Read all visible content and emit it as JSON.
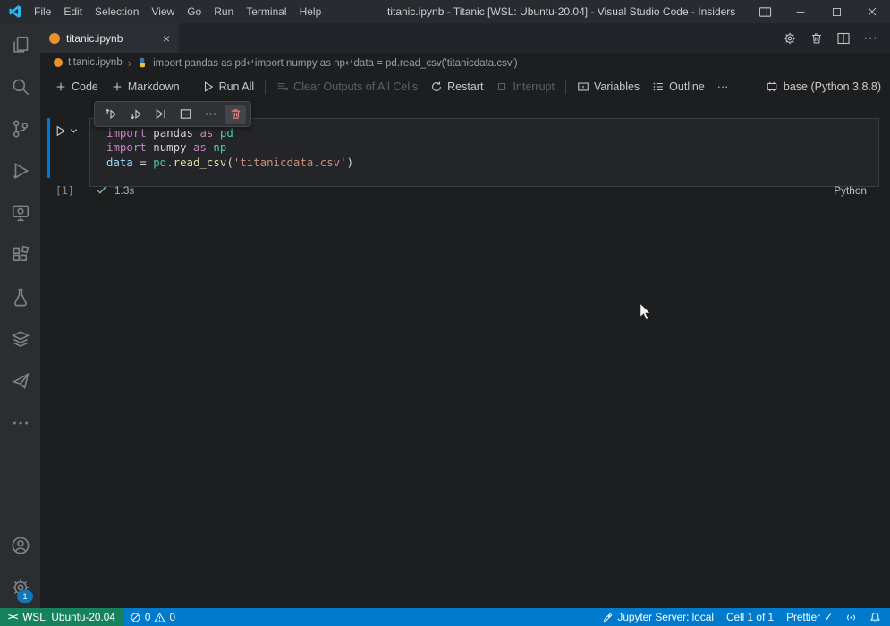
{
  "colors": {
    "titlebar-bg": "#282c30",
    "activitybar-bg": "#2b2d31",
    "editor-bg": "#1d1e20",
    "tabstrip-bg": "#222429",
    "tab-bg": "#2b2e33",
    "cell-editor-bg": "#242528",
    "cell-border": "#3a3d41",
    "toolbar-popup-bg": "#303134",
    "statusbar-bg": "#007acc",
    "remote-bg": "#16825d",
    "focus-blue": "#0078d4",
    "jupyter-orange": "#e8912d",
    "badge-blue": "#1177bb",
    "delete-red": "#f0807a",
    "success-green": "#73c991",
    "logo-teal": "#2fb4e9",
    "syn-kw": "#c586c0",
    "syn-mod": "#d4d4d4",
    "syn-cls": "#4ec9b0",
    "syn-var": "#9cdcfe",
    "syn-fn": "#dcdcaa",
    "syn-str": "#ce9178",
    "syn-plain": "#d4d4d4"
  },
  "icons": {
    "close": "×",
    "chevron": "›",
    "more": "···",
    "remote": "><",
    "check": "✓"
  },
  "titlebar": {
    "menus": [
      "File",
      "Edit",
      "Selection",
      "View",
      "Go",
      "Run",
      "Terminal",
      "Help"
    ],
    "title": "titanic.ipynb - Titanic [WSL: Ubuntu-20.04] - Visual Studio Code - Insiders"
  },
  "tab": {
    "label": "titanic.ipynb"
  },
  "breadcrumb": {
    "file": "titanic.ipynb",
    "cell_preview": "import pandas as pd↵import numpy as np↵data = pd.read_csv('titanicdata.csv')"
  },
  "notebook_toolbar": {
    "code": "Code",
    "markdown": "Markdown",
    "run_all": "Run All",
    "clear_outputs": "Clear Outputs of All Cells",
    "restart": "Restart",
    "interrupt": "Interrupt",
    "variables": "Variables",
    "outline": "Outline",
    "kernel": "base (Python 3.8.8)"
  },
  "cell": {
    "execution_count": "[1]",
    "duration": "1.3s",
    "language": "Python",
    "code_tokens": [
      [
        {
          "t": "import",
          "c": "kw"
        },
        {
          "t": " ",
          "c": "plain"
        },
        {
          "t": "pandas",
          "c": "mod"
        },
        {
          "t": " ",
          "c": "plain"
        },
        {
          "t": "as",
          "c": "kw"
        },
        {
          "t": " ",
          "c": "plain"
        },
        {
          "t": "pd",
          "c": "cls"
        }
      ],
      [
        {
          "t": "import",
          "c": "kw"
        },
        {
          "t": " ",
          "c": "plain"
        },
        {
          "t": "numpy",
          "c": "mod"
        },
        {
          "t": " ",
          "c": "plain"
        },
        {
          "t": "as",
          "c": "kw"
        },
        {
          "t": " ",
          "c": "plain"
        },
        {
          "t": "np",
          "c": "cls"
        }
      ],
      [
        {
          "t": "data",
          "c": "var"
        },
        {
          "t": " = ",
          "c": "plain"
        },
        {
          "t": "pd",
          "c": "cls"
        },
        {
          "t": ".",
          "c": "plain"
        },
        {
          "t": "read_csv",
          "c": "fn"
        },
        {
          "t": "(",
          "c": "plain"
        },
        {
          "t": "'titanicdata.csv'",
          "c": "str"
        },
        {
          "t": ")",
          "c": "plain"
        }
      ]
    ]
  },
  "statusbar": {
    "remote": "WSL: Ubuntu-20.04",
    "errors": "0",
    "warnings": "0",
    "jupyter_server": "Jupyter Server: local",
    "cell_position": "Cell 1 of 1",
    "formatter": "Prettier"
  }
}
